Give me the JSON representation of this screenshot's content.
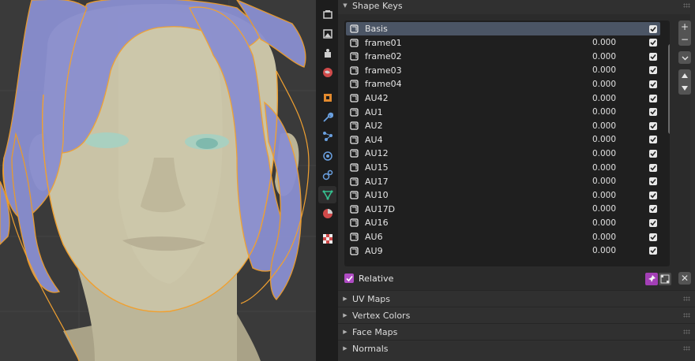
{
  "shape_keys": {
    "panel_title": "Shape Keys",
    "items": [
      {
        "name": "Basis",
        "value": "",
        "checked": true,
        "selected": true
      },
      {
        "name": "frame01",
        "value": "0.000",
        "checked": true
      },
      {
        "name": "frame02",
        "value": "0.000",
        "checked": true
      },
      {
        "name": "frame03",
        "value": "0.000",
        "checked": true
      },
      {
        "name": "frame04",
        "value": "0.000",
        "checked": true
      },
      {
        "name": "AU42",
        "value": "0.000",
        "checked": true
      },
      {
        "name": "AU1",
        "value": "0.000",
        "checked": true
      },
      {
        "name": "AU2",
        "value": "0.000",
        "checked": true
      },
      {
        "name": "AU4",
        "value": "0.000",
        "checked": true
      },
      {
        "name": "AU12",
        "value": "0.000",
        "checked": true
      },
      {
        "name": "AU15",
        "value": "0.000",
        "checked": true
      },
      {
        "name": "AU17",
        "value": "0.000",
        "checked": true
      },
      {
        "name": "AU10",
        "value": "0.000",
        "checked": true
      },
      {
        "name": "AU17D",
        "value": "0.000",
        "checked": true
      },
      {
        "name": "AU16",
        "value": "0.000",
        "checked": true
      },
      {
        "name": "AU6",
        "value": "0.000",
        "checked": true
      },
      {
        "name": "AU9",
        "value": "0.000",
        "checked": true
      }
    ],
    "relative_label": "Relative",
    "relative_checked": true,
    "add_label": "+",
    "remove_label": "−",
    "close_label": "✕"
  },
  "collapsed_panels": [
    {
      "label": "UV Maps"
    },
    {
      "label": "Vertex Colors"
    },
    {
      "label": "Face Maps"
    },
    {
      "label": "Normals"
    }
  ],
  "tabs": [
    {
      "icon": "render-icon"
    },
    {
      "icon": "output-icon"
    },
    {
      "icon": "view-layer-icon"
    },
    {
      "icon": "world-icon"
    },
    {
      "icon": "object-icon"
    },
    {
      "icon": "modifier-icon"
    },
    {
      "icon": "particles-icon"
    },
    {
      "icon": "physics-icon"
    },
    {
      "icon": "constraints-icon"
    },
    {
      "icon": "object-data-icon",
      "active": true
    },
    {
      "icon": "material-icon"
    },
    {
      "icon": "texture-icon"
    }
  ],
  "colors": {
    "accent_checkbox": "#b04cc4",
    "selection": "#4b5565",
    "hair": "#8a8fd0",
    "skin": "#c9c3a6",
    "outline": "#f0a030"
  }
}
